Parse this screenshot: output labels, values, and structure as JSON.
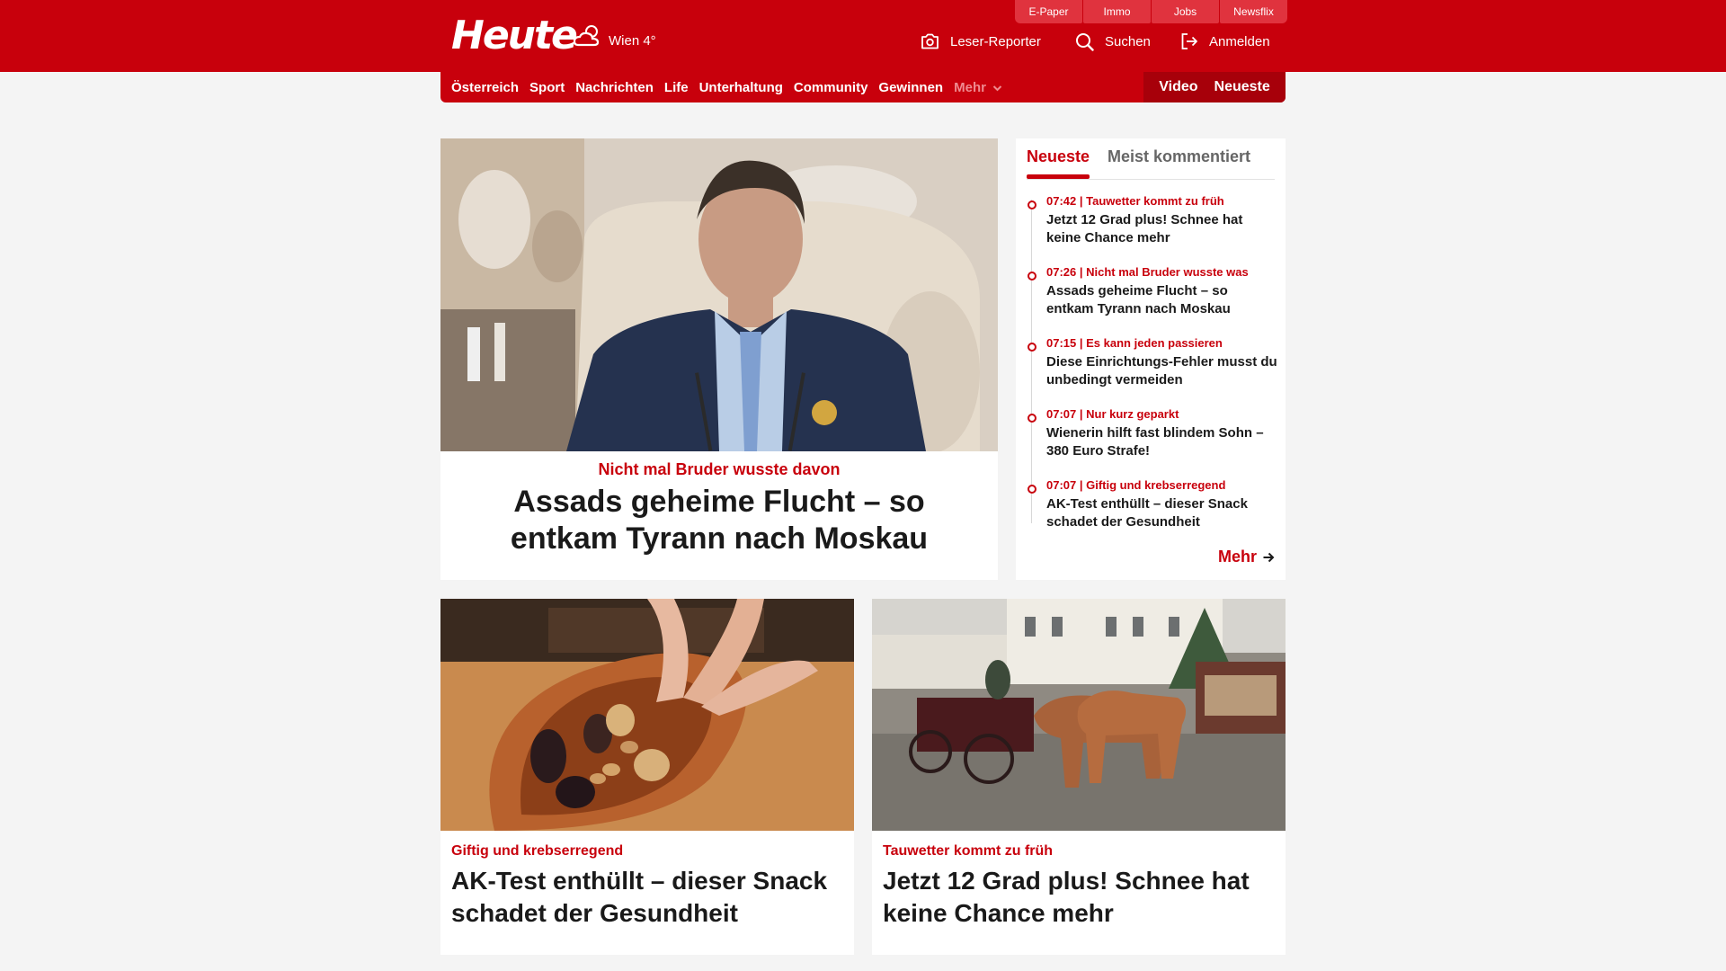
{
  "header": {
    "logo_text": "Heute",
    "weather": "Wien 4°",
    "service_links": [
      "E-Paper",
      "Immo",
      "Jobs",
      "Newsflix"
    ],
    "reporter_label": "Leser-Reporter",
    "search_label": "Suchen",
    "login_label": "Anmelden"
  },
  "nav": {
    "items": [
      "Österreich",
      "Sport",
      "Nachrichten",
      "Life",
      "Unterhaltung",
      "Community",
      "Gewinnen"
    ],
    "more_label": "Mehr",
    "video_label": "Video",
    "neueste_label": "Neueste"
  },
  "hero": {
    "kicker": "Nicht mal Bruder wusste davon",
    "title": "Assads geheime Flucht – so entkam Tyrann nach Moskau"
  },
  "sidebar": {
    "tab_active": "Neueste",
    "tab_other": "Meist kommentiert",
    "items": [
      {
        "kicker": "07:42 | Tauwetter kommt zu früh",
        "title": "Jetzt 12 Grad plus! Schnee hat keine Chance mehr"
      },
      {
        "kicker": "07:26 | Nicht mal Bruder wusste was",
        "title": "Assads geheime Flucht – so entkam Tyrann nach Moskau"
      },
      {
        "kicker": "07:15 | Es kann jeden passieren",
        "title": "Diese Einrichtungs-Fehler musst du unbedingt vermeiden"
      },
      {
        "kicker": "07:07 | Nur kurz geparkt",
        "title": "Wienerin hilft fast blindem Sohn – 380 Euro Strafe!"
      },
      {
        "kicker": "07:07 | Giftig und krebserregend",
        "title": "AK-Test enthüllt – dieser Snack schadet der Gesundheit"
      }
    ],
    "more_label": "Mehr"
  },
  "cards": [
    {
      "kicker": "Giftig und krebserregend",
      "title": "AK-Test enthüllt – dieser Snack schadet der Gesundheit"
    },
    {
      "kicker": "Tauwetter kommt zu früh",
      "title": "Jetzt 12 Grad plus! Schnee hat keine Chance mehr"
    }
  ],
  "colors": {
    "brand": "#c8000c",
    "brand_dark": "#a7000a",
    "service_tab": "#e0333e",
    "background": "#f4f4f4"
  },
  "icons": [
    "weather-cloud-sun-icon",
    "camera-icon",
    "search-icon",
    "login-icon",
    "chevron-down-icon",
    "arrow-right-icon"
  ]
}
